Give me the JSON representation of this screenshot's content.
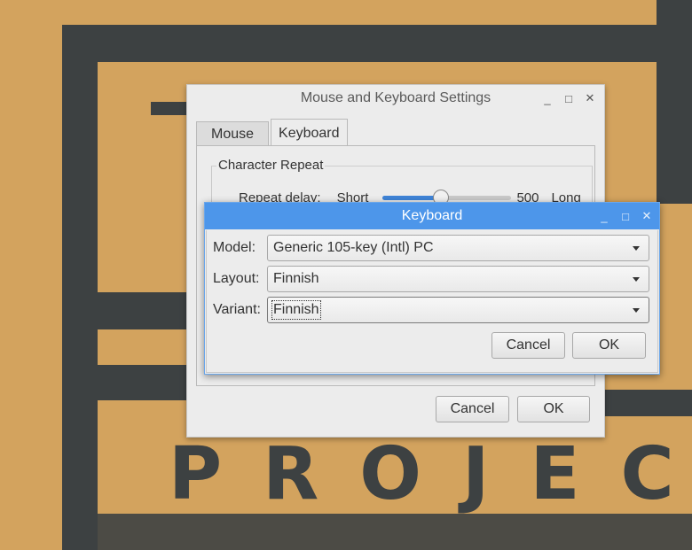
{
  "wallpaper": {
    "text": "PROJECTS"
  },
  "main_window": {
    "title": "Mouse and Keyboard Settings",
    "controls": {
      "minimize": "_",
      "maximize": "□",
      "close": "✕"
    },
    "tabs": [
      {
        "label": "Mouse",
        "active": false
      },
      {
        "label": "Keyboard",
        "active": true
      }
    ],
    "character_repeat": {
      "group_label": "Character Repeat",
      "delay_label": "Repeat delay:",
      "short_label": "Short",
      "value": "500",
      "long_label": "Long",
      "slider_fraction": 0.45
    },
    "buttons": {
      "cancel": "Cancel",
      "ok": "OK"
    }
  },
  "keyboard_dialog": {
    "title": "Keyboard",
    "controls": {
      "minimize": "_",
      "maximize": "□",
      "close": "✕"
    },
    "model": {
      "label": "Model:",
      "value": "Generic 105-key (Intl) PC"
    },
    "layout": {
      "label": "Layout:",
      "value": "Finnish"
    },
    "variant": {
      "label": "Variant:",
      "value": "Finnish"
    },
    "buttons": {
      "cancel": "Cancel",
      "ok": "OK"
    }
  },
  "colors": {
    "accent": "#4d96ea",
    "slider_fill": "#3f84d8",
    "wallpaper": "#d3a35e",
    "wallpaper_ink": "#3d4142"
  }
}
